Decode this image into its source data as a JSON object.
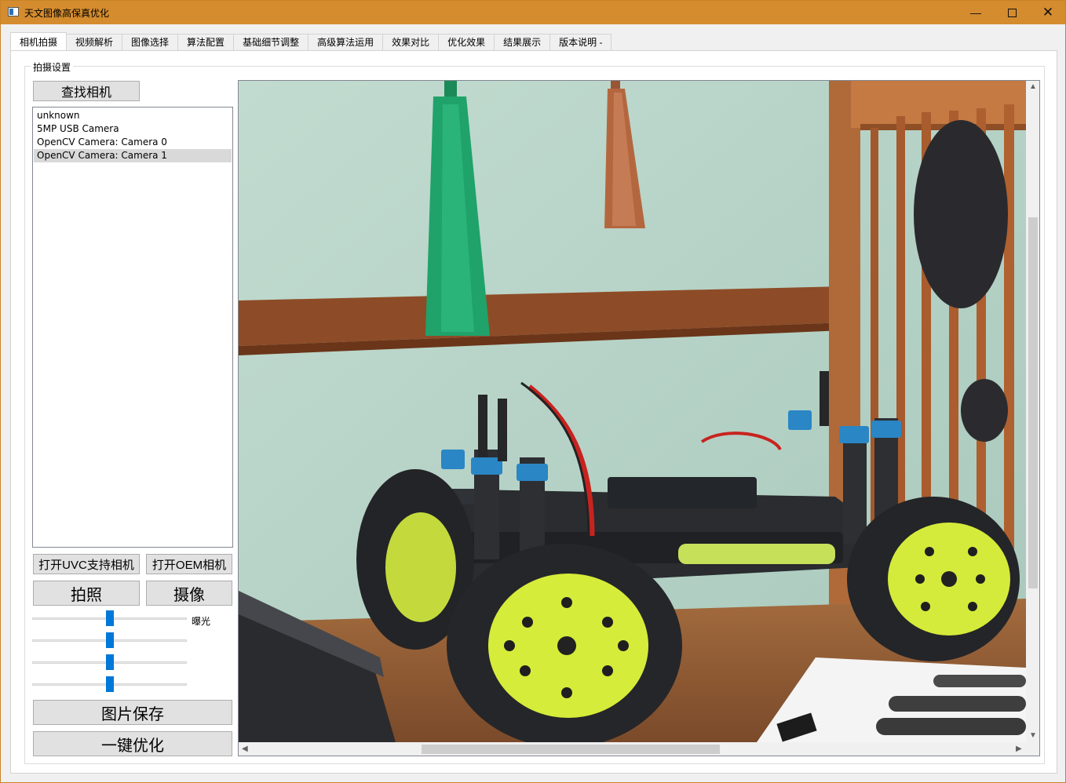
{
  "window": {
    "title": "天文图像高保真优化",
    "icon": "app-window-icon",
    "controls": {
      "minimize": "—",
      "close": "✕"
    }
  },
  "tabs": [
    {
      "label": "相机拍摄",
      "active": true
    },
    {
      "label": "视频解析"
    },
    {
      "label": "图像选择"
    },
    {
      "label": "算法配置"
    },
    {
      "label": "基础细节调整"
    },
    {
      "label": "高级算法运用"
    },
    {
      "label": "效果对比"
    },
    {
      "label": "优化效果"
    },
    {
      "label": "结果展示"
    },
    {
      "label": "版本说明 -"
    }
  ],
  "capture": {
    "group_title": "拍摄设置",
    "find_camera_button": "查找相机",
    "camera_list": [
      {
        "label": "unknown"
      },
      {
        "label": "5MP USB Camera"
      },
      {
        "label": "OpenCV Camera: Camera 0"
      },
      {
        "label": "OpenCV Camera: Camera 1",
        "selected": true
      }
    ],
    "open_uvc_button": "打开UVC支持相机",
    "open_oem_button": "打开OEM相机",
    "photo_button": "拍照",
    "video_button": "摄像",
    "sliders": [
      {
        "label": "曝光",
        "value": 0.5
      },
      {
        "value": 0.5
      },
      {
        "value": 0.5
      },
      {
        "value": 0.5
      }
    ],
    "save_button": "图片保存",
    "optimize_button": "一键优化"
  },
  "viewer": {
    "vertical_scroll": 0.21,
    "horizontal_scroll": 0.23,
    "scroll_up": "▲",
    "scroll_down": "▼",
    "scroll_left": "◀",
    "scroll_right": "▶"
  },
  "colors": {
    "titlebar": "#d58c2e",
    "slider_thumb": "#0078d7",
    "wall": "#b7d2c6",
    "shelf": "#8a4a26",
    "wheel": "#d6ec3a",
    "tassel_green": "#1fa36a",
    "tassel_copper": "#b4673f"
  }
}
